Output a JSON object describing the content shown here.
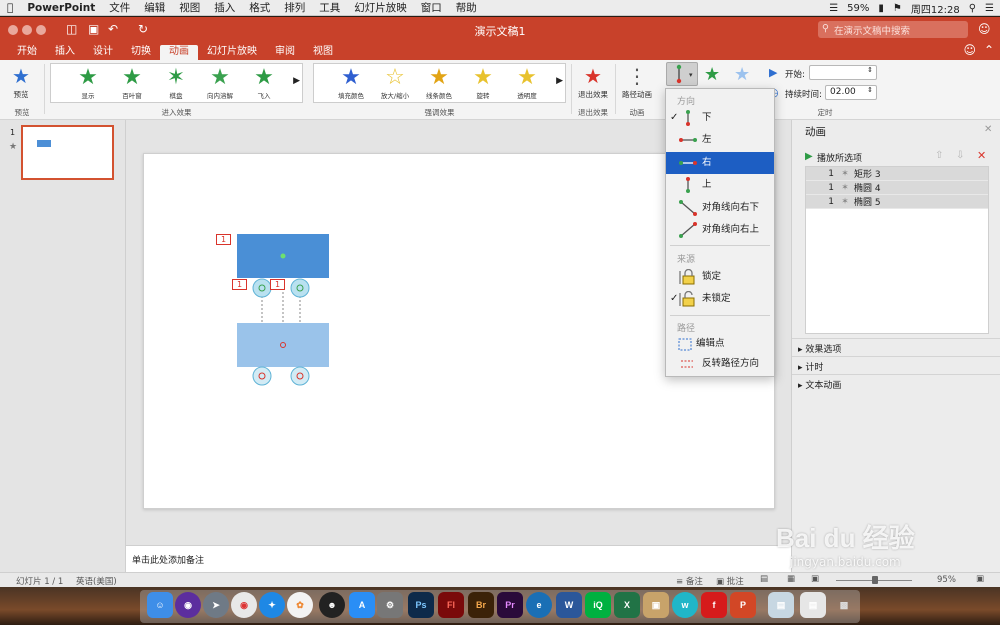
{
  "menubar": {
    "app": "PowerPoint",
    "items": [
      "文件",
      "编辑",
      "视图",
      "插入",
      "格式",
      "排列",
      "工具",
      "幻灯片放映",
      "窗口",
      "帮助"
    ],
    "battery": "59%",
    "datetime": "周四12:28"
  },
  "window": {
    "title": "演示文稿1",
    "search_placeholder": "在演示文稿中搜索"
  },
  "tabs": [
    "开始",
    "插入",
    "设计",
    "切换",
    "动画",
    "幻灯片放映",
    "审阅",
    "视图"
  ],
  "ribbon": {
    "preview_label": "预览",
    "preview_group": "预览",
    "entrance": [
      {
        "label": "显示",
        "color": "#2e9b45"
      },
      {
        "label": "百叶窗",
        "color": "#2e9b45"
      },
      {
        "label": "棋盘",
        "color": "#2e9b45"
      },
      {
        "label": "向内溶解",
        "color": "#3aa14f"
      },
      {
        "label": "飞入",
        "color": "#2e9b45"
      }
    ],
    "entrance_group": "进入效果",
    "emphasis": [
      {
        "label": "填充颜色",
        "color": "#e2a415"
      },
      {
        "label": "放大/缩小",
        "color": "#e8c22e"
      },
      {
        "label": "线条颜色",
        "color": "#e2a415"
      },
      {
        "label": "旋转",
        "color": "#e8c22e"
      },
      {
        "label": "透明度",
        "color": "#e8c22e"
      }
    ],
    "emphasis_group": "强调效果",
    "exit_label": "退出效果",
    "exit_group": "退出效果",
    "path_label": "路径动画",
    "anim_group": "动画",
    "start_label": "开始:",
    "start_value": "",
    "duration_label": "持续时间:",
    "duration_value": "02.00",
    "timing_group": "定时"
  },
  "slide_panel": {
    "slide_number": "1"
  },
  "slide": {
    "tags": [
      "1",
      "1",
      "1"
    ]
  },
  "notes_placeholder": "单击此处添加备注",
  "animation_panel": {
    "title": "动画",
    "play_label": "播放所选项",
    "items": [
      {
        "order": "1",
        "name": "矩形 3"
      },
      {
        "order": "1",
        "name": "椭圆 4"
      },
      {
        "order": "1",
        "name": "椭圆 5"
      }
    ],
    "sections": [
      "效果选项",
      "计时",
      "文本动画"
    ]
  },
  "dropdown": {
    "direction_header": "方向",
    "directions": [
      "下",
      "左",
      "右",
      "上",
      "对角线向右下",
      "对角线向右上"
    ],
    "selected_direction": "右",
    "origin_header": "来源",
    "origins": [
      "锁定",
      "未锁定"
    ],
    "checked_origin": "未锁定",
    "path_header": "路径",
    "path_items": [
      "编辑点",
      "反转路径方向"
    ]
  },
  "status": {
    "slide_info": "幻灯片 1 / 1",
    "language": "英语(美国)",
    "notes": "备注",
    "comments": "批注",
    "zoom": "95%"
  },
  "dock": [
    {
      "label": "Ps",
      "color": "#0d2a4a"
    },
    {
      "label": "Fl",
      "color": "#7a0a0a"
    },
    {
      "label": "Br",
      "color": "#3b2208"
    },
    {
      "label": "Pr",
      "color": "#2a0a3a"
    }
  ],
  "watermark": {
    "line1": "Bai du 经验",
    "line2": "jingyan.baidu.com"
  }
}
